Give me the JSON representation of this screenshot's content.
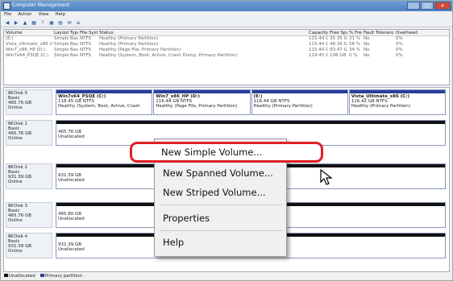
{
  "window": {
    "title": "Computer Management",
    "controls": {
      "min": "–",
      "max": "□",
      "close": "✕"
    }
  },
  "menu": [
    "File",
    "Action",
    "View",
    "Help"
  ],
  "toolbar_icons": [
    "back-icon",
    "forward-icon",
    "up-icon",
    "properties-icon",
    "help-icon",
    "connect-icon",
    "folder-icon",
    "mail-icon",
    "list-icon"
  ],
  "volume_table": {
    "headers": [
      "Volume",
      "Layout",
      "Type",
      "File System",
      "Status",
      "Capacity",
      "Free Space",
      "% Free",
      "Fault Tolerance",
      "Overhead"
    ],
    "rows": [
      [
        "(E:)",
        "Simple",
        "Basic",
        "NTFS",
        "Healthy (Primary Partition)",
        "115.44 GB",
        "35.35 GB",
        "31 %",
        "No",
        "0%"
      ],
      [
        "Vista_Ultimate_x86 (C:)",
        "Simple",
        "Basic",
        "NTFS",
        "Healthy (Primary Partition)",
        "115.44 GB",
        "48.39 GB",
        "58 %",
        "No",
        "0%"
      ],
      [
        "Win7_x86_HP (D:)",
        "Simple",
        "Basic",
        "NTFS",
        "Healthy (Page File, Primary Partition)",
        "115.44 GB",
        "93.47 GB",
        "34 %",
        "No",
        "0%"
      ],
      [
        "Win7x64_PSQE (C:)",
        "Simple",
        "Basic",
        "NTFS",
        "Healthy (System, Boot, Active, Crash Dump, Primary Partition)",
        "114.45 GB",
        "108 GB",
        "0 %",
        "No",
        "0%"
      ]
    ]
  },
  "disks": [
    {
      "name": "Disk 0",
      "type": "Basic",
      "size": "465.76 GB",
      "state": "Online",
      "partitions": [
        {
          "title": "Win7x64_PSQE (C:)",
          "size": "118.45 GB NTFS",
          "status": "Healthy (System, Boot, Active, Crash",
          "unalloc": false
        },
        {
          "title": "Win7_x86_HP (D:)",
          "size": "116.44 GB NTFS",
          "status": "Healthy (Page File, Primary Partition)",
          "unalloc": false
        },
        {
          "title": "(E:)",
          "size": "116.44 GB NTFS",
          "status": "Healthy (Primary Partition)",
          "unalloc": false
        },
        {
          "title": "Vista_Ultimate_x86 (C:)",
          "size": "116.42 GB NTFS",
          "status": "Healthy (Primary Partition)",
          "unalloc": false
        }
      ]
    },
    {
      "name": "Disk 1",
      "type": "Basic",
      "size": "465.76 GB",
      "state": "Online",
      "partitions": [
        {
          "title": "",
          "size": "465.76 GB",
          "status": "Unallocated",
          "unalloc": true
        }
      ]
    },
    {
      "name": "Disk 2",
      "type": "Basic",
      "size": "931.39 GB",
      "state": "Online",
      "partitions": [
        {
          "title": "",
          "size": "931.39 GB",
          "status": "Unallocated",
          "unalloc": true
        }
      ]
    },
    {
      "name": "Disk 3",
      "type": "Basic",
      "size": "465.76 GB",
      "state": "Online",
      "partitions": [
        {
          "title": "",
          "size": "465.80 GB",
          "status": "Unallocated",
          "unalloc": true
        }
      ]
    },
    {
      "name": "Disk 4",
      "type": "Basic",
      "size": "931.39 GB",
      "state": "Online",
      "partitions": [
        {
          "title": "",
          "size": "931.39 GB",
          "status": "Unallocated",
          "unalloc": true
        }
      ]
    }
  ],
  "legend": [
    {
      "label": "Unallocated",
      "color": "#111111"
    },
    {
      "label": "Primary partition",
      "color": "#2c3e9a"
    }
  ],
  "context_menu": {
    "items": [
      "New Simple Volume...",
      "New Spanned Volume...",
      "New Striped Volume...",
      "Properties",
      "Help"
    ],
    "highlighted": "New Simple Volume..."
  },
  "colors": {
    "highlight_ring": "#e01e25",
    "primary_band": "#2c3e9a",
    "unallocated_band": "#111111"
  }
}
